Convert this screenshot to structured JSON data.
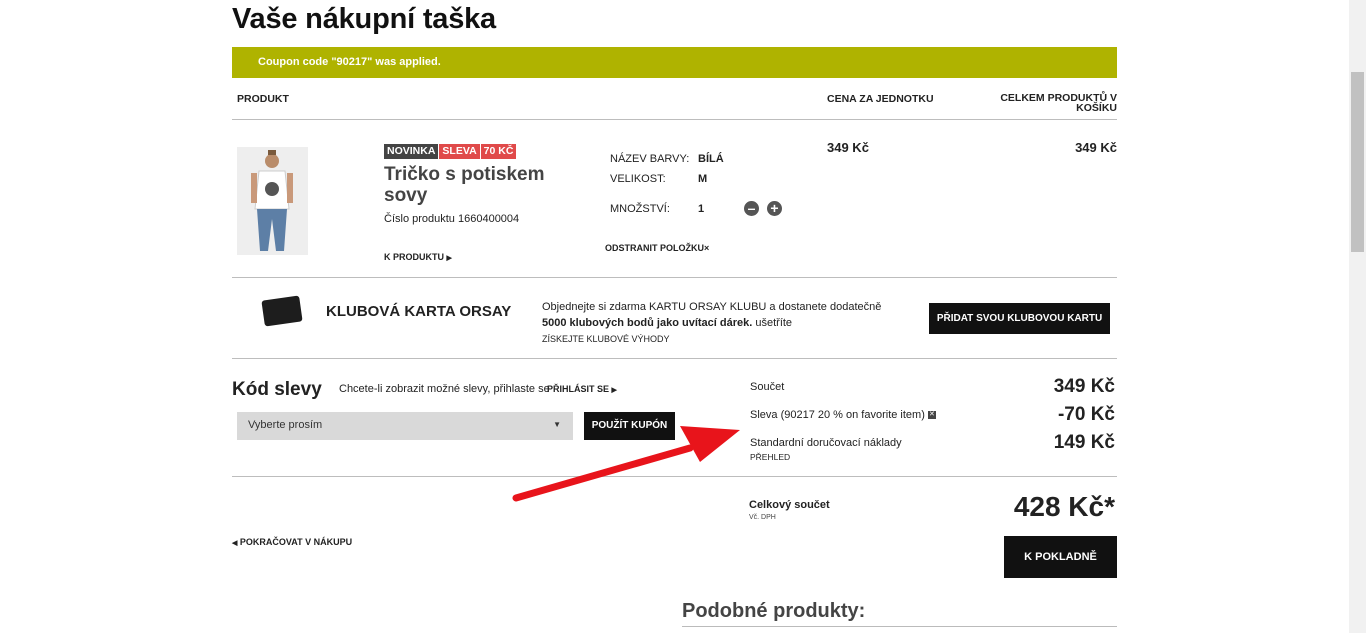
{
  "page": {
    "title": "Vaše nákupní taška"
  },
  "coupon_message": "Coupon code \"90217\" was applied.",
  "columns": {
    "product": "PRODUKT",
    "unit_price": "CENA ZA JEDNOTKU",
    "total": "CELKEM PRODUKTŮ V KOŠÍKU"
  },
  "item": {
    "badges": [
      "NOVINKA",
      "SLEVA",
      "70 KČ"
    ],
    "name": "Tričko s potiskem sovy",
    "number": "Číslo produktu 1660400004",
    "link": "K PRODUKTU",
    "color_label": "NÁZEV BARVY:",
    "color_value": "BÍLÁ",
    "size_label": "VELIKOST:",
    "size_value": "M",
    "qty_label": "MNOŽSTVÍ:",
    "qty_value": "1",
    "remove": "ODSTRANIT POLOŽKU",
    "unit_price": "349 Kč",
    "total_price": "349 Kč"
  },
  "club": {
    "title": "KLUBOVÁ KARTA ORSAY",
    "text_plain": "Objednejte si zdarma KARTU ORSAY KLUBU a dostanete dodatečně",
    "text_bold": "5000 klubových bodů jako uvítací dárek.",
    "text_tail": " ušetříte",
    "link": "ZÍSKEJTE KLUBOVÉ VÝHODY",
    "button": "PŘIDAT SVOU KLUBOVOU KARTU"
  },
  "discount": {
    "title": "Kód slevy",
    "hint": "Chcete-li zobrazit možné slevy, přihlaste se",
    "login": "PŘIHLÁSIT SE",
    "select_value": "Vyberte prosím",
    "apply_button": "POUŽÍT KUPÓN"
  },
  "summary": {
    "subtotal_label": "Součet",
    "subtotal_value": "349 Kč",
    "discount_label": "Sleva (90217 20 % on favorite item)",
    "discount_value": "-70 Kč",
    "shipping_label": "Standardní doručovací náklady",
    "shipping_sub": "PŘEHLED",
    "shipping_value": "149 Kč",
    "grand_label": "Celkový součet",
    "grand_sub": "Vč. DPH",
    "grand_value": "428 Kč*",
    "checkout_button": "K POKLADNĚ"
  },
  "continue_link": "POKRAČOVAT V NÁKUPU",
  "similar_title": "Podobné produkty:",
  "colors": {
    "coupon_bar": "#afb300",
    "sale": "#e04a4a",
    "arrow": "#e8141b"
  }
}
